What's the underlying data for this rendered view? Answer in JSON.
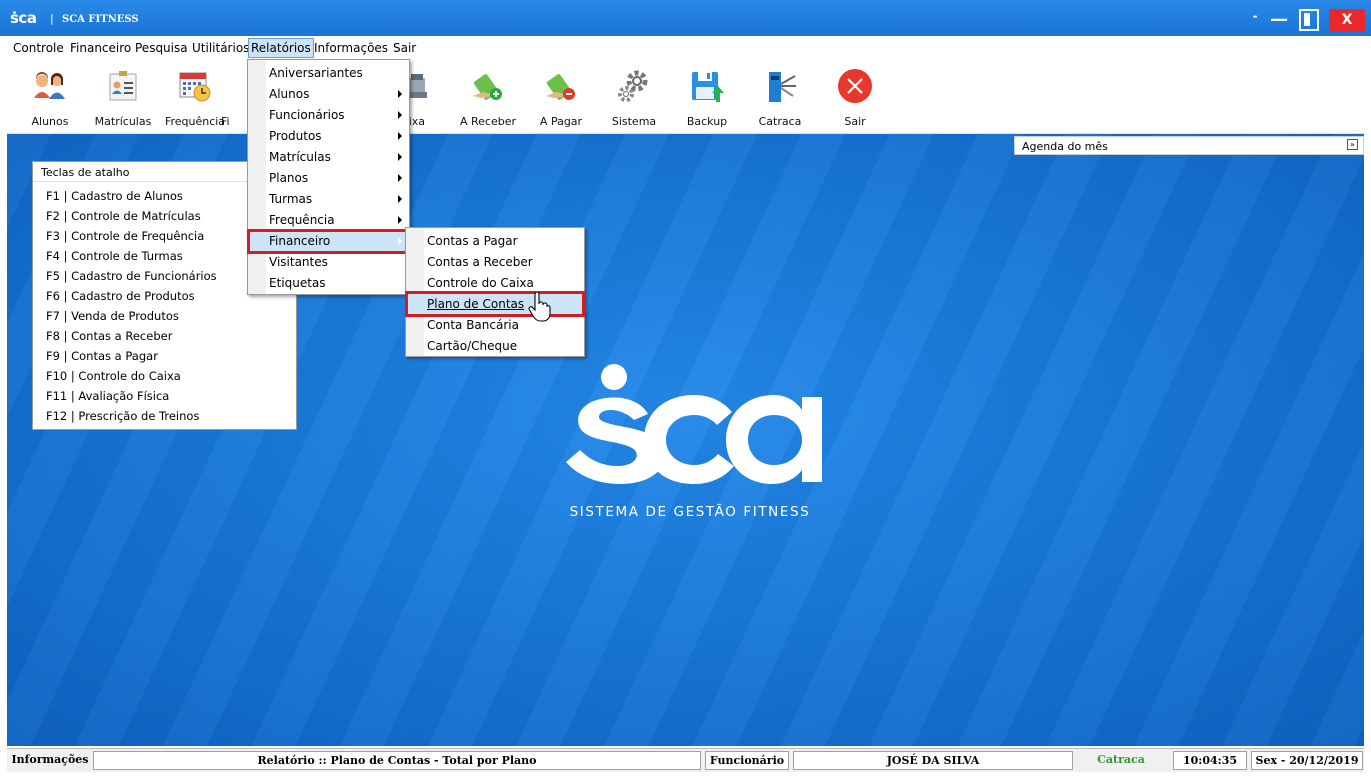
{
  "window": {
    "logo": "ṡca",
    "separator": "|",
    "title": "SCA FITNESS",
    "controls": {
      "dash": "-",
      "minimize": "—",
      "close": "X"
    }
  },
  "menubar": [
    "Controle",
    "Financeiro",
    "Pesquisa",
    "Utilitários",
    "Relatórios",
    "Informações",
    "Sair"
  ],
  "toolbar": [
    "Alunos",
    "Matrículas",
    "Frequência",
    "Fi",
    "aixa",
    "A Receber",
    "A Pagar",
    "Sistema",
    "Backup",
    "Catraca",
    "Sair"
  ],
  "relatorios_menu": [
    "Aniversariantes",
    "Alunos",
    "Funcionários",
    "Produtos",
    "Matrículas",
    "Planos",
    "Turmas",
    "Frequência",
    "Financeiro",
    "Visitantes",
    "Etiquetas"
  ],
  "financeiro_menu": [
    "Contas a Pagar",
    "Contas a Receber",
    "Controle do Caixa",
    "Plano de Contas",
    "Conta Bancária",
    "Cartão/Cheque"
  ],
  "agenda": {
    "title": "Agenda do mês",
    "toggle": "»"
  },
  "shortcuts": {
    "title": "Teclas de atalho",
    "items": [
      "F1 | Cadastro de Alunos",
      "F2 | Controle de Matrículas",
      "F3 | Controle de Frequência",
      "F4 | Controle de Turmas",
      "F5 | Cadastro de Funcionários",
      "F6 | Cadastro de Produtos",
      "F7 | Venda de Produtos",
      "F8 | Contas a Receber",
      "F9 | Contas a Pagar",
      "F10 | Controle do Caixa",
      "F11 | Avaliação Física",
      "F12 | Prescrição de Treinos"
    ]
  },
  "brand": {
    "logo": "ṡca",
    "tagline": "SISTEMA DE GESTÃO FITNESS"
  },
  "status": {
    "label1": "Informações",
    "info": "Relatório :: Plano de Contas - Total por Plano",
    "label2": "Funcionário",
    "user": "JOSÉ DA SILVA",
    "catraca": "Catraca",
    "time": "10:04:35",
    "date": "Sex - 20/12/2019"
  },
  "colors": {
    "accent": "#1a74d6",
    "highlight": "#cce4f7",
    "outline": "#d41c24",
    "close": "#e8282a",
    "catraca": "#2e9a2e"
  }
}
